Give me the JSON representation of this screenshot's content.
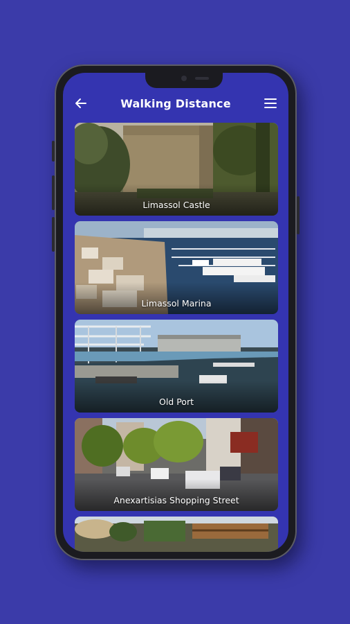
{
  "header": {
    "title": "Walking Distance",
    "back_icon": "arrow-left-icon",
    "menu_icon": "hamburger-menu-icon"
  },
  "places": [
    {
      "name": "Limassol Castle",
      "photo": "castle-stone-wall"
    },
    {
      "name": "Limassol Marina",
      "photo": "marina-boats"
    },
    {
      "name": "Old Port",
      "photo": "harbor-pier"
    },
    {
      "name": "Anexartisias Shopping Street",
      "photo": "tree-lined-street"
    },
    {
      "name": "",
      "photo": "outdoor-cafe"
    }
  ],
  "colors": {
    "background": "#3b3ba9",
    "screen": "#3434b0",
    "text": "#ffffff"
  }
}
